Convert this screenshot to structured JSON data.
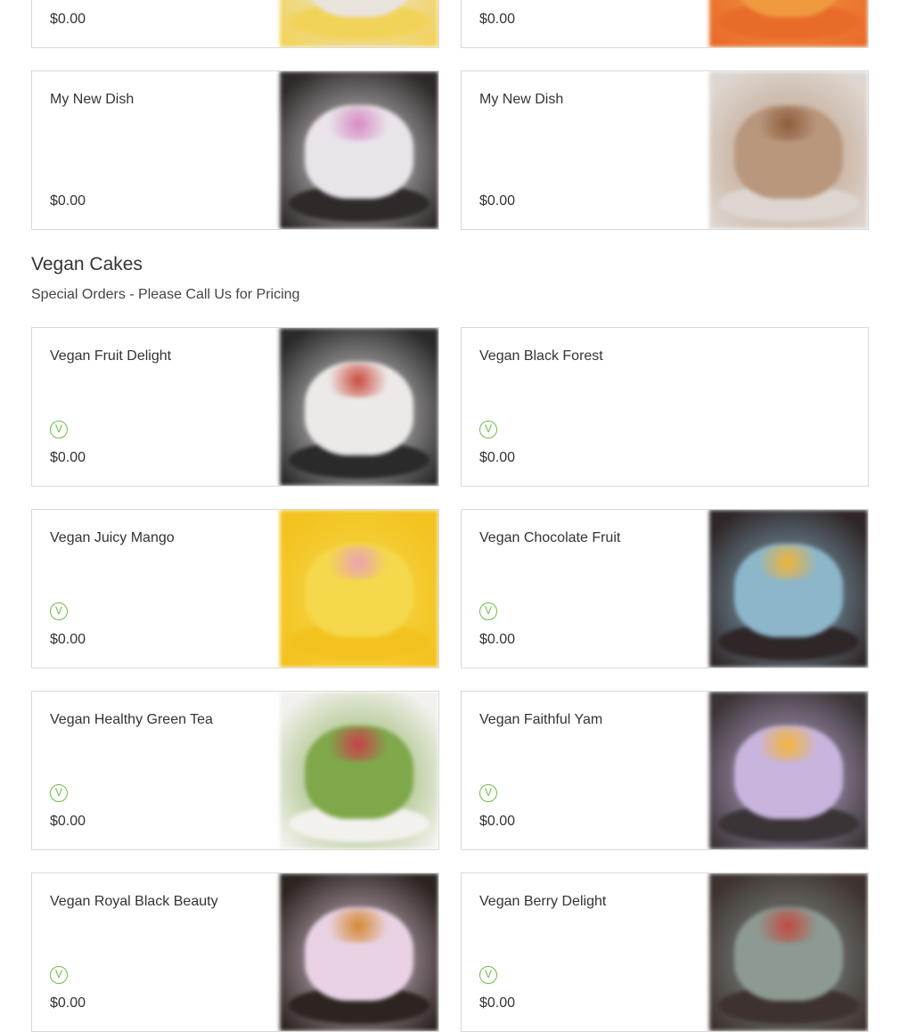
{
  "top_cards": [
    {
      "price": "$0.00",
      "image": "cake-photo",
      "colors": [
        "#f2d35a",
        "#e9e4de",
        "#c9b9a4"
      ]
    },
    {
      "price": "$0.00",
      "image": "cake-photo",
      "colors": [
        "#e96b2a",
        "#f09a40",
        "#c7602a"
      ]
    },
    {
      "name": "My New Dish",
      "price": "$0.00",
      "image": "cake-photo",
      "colors": [
        "#2f2a29",
        "#e8e4ea",
        "#d98ac5"
      ]
    },
    {
      "name": "My New Dish",
      "price": "$0.00",
      "image": "cake-photo",
      "colors": [
        "#ddd6d0",
        "#b9977d",
        "#8c5d3a"
      ]
    }
  ],
  "section": {
    "title": "Vegan Cakes",
    "subtitle": "Special Orders - Please Call Us for Pricing"
  },
  "vegan_cards": [
    {
      "name": "Vegan Fruit Delight",
      "badge": "V",
      "price": "$0.00",
      "image": "cake-photo",
      "colors": [
        "#2a2a2a",
        "#ece9e8",
        "#c94b3b"
      ]
    },
    {
      "name": "Vegan Black Forest",
      "badge": "V",
      "price": "$0.00"
    },
    {
      "name": "Vegan Juicy Mango",
      "badge": "V",
      "price": "$0.00",
      "image": "cake-photo",
      "colors": [
        "#f3c21e",
        "#f5d84b",
        "#e9a3b5"
      ]
    },
    {
      "name": "Vegan Chocolate Fruit",
      "badge": "V",
      "price": "$0.00",
      "image": "cake-photo",
      "colors": [
        "#2f2628",
        "#8cb6c9",
        "#f0b437"
      ]
    },
    {
      "name": "Vegan Healthy Green Tea",
      "badge": "V",
      "price": "$0.00",
      "image": "cake-photo",
      "colors": [
        "#f3f1ee",
        "#7fa84b",
        "#c9404a"
      ]
    },
    {
      "name": "Vegan Faithful Yam",
      "badge": "V",
      "price": "$0.00",
      "image": "cake-photo",
      "colors": [
        "#3a3437",
        "#c8b4dd",
        "#f3b53b"
      ]
    },
    {
      "name": "Vegan Royal Black Beauty",
      "badge": "V",
      "price": "$0.00",
      "image": "cake-photo",
      "colors": [
        "#2b2420",
        "#e9d2e4",
        "#d4882f"
      ]
    },
    {
      "name": "Vegan Berry Delight",
      "badge": "V",
      "price": "$0.00",
      "image": "cake-photo",
      "colors": [
        "#3d3230",
        "#8c9a91",
        "#c24a3f"
      ]
    }
  ],
  "accent_color": "#6cbe45"
}
